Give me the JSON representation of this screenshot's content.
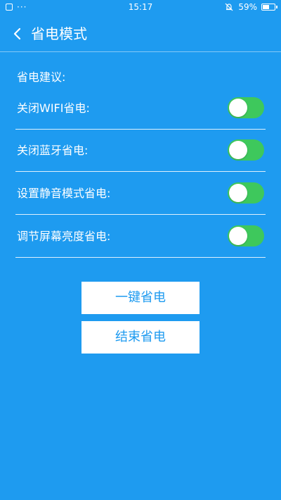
{
  "status_bar": {
    "time": "15:17",
    "battery": "59%",
    "battery_level": 0.59,
    "dots": "···"
  },
  "header": {
    "title": "省电模式"
  },
  "suggestions": {
    "label": "省电建议:",
    "items": [
      {
        "label": "关闭WIFI省电:",
        "enabled": false
      },
      {
        "label": "关闭蓝牙省电:",
        "enabled": false
      },
      {
        "label": "设置静音模式省电:",
        "enabled": false
      },
      {
        "label": "调节屏幕亮度省电:",
        "enabled": false
      }
    ]
  },
  "actions": {
    "one_click": "一键省电",
    "end": "结束省电"
  },
  "colors": {
    "background": "#1e9bf0",
    "toggle_track": "#3ec85c",
    "button_text": "#1e9bf0"
  }
}
